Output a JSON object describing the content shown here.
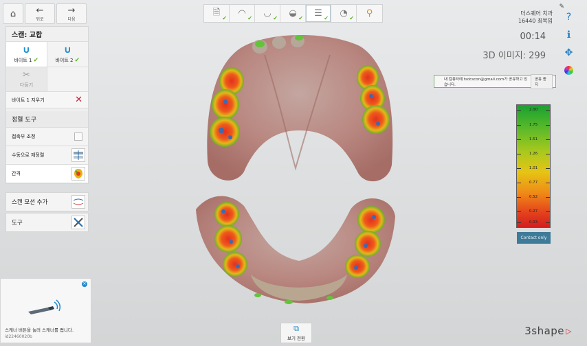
{
  "nav": {
    "home_icon": "home-icon",
    "back_label": "뒤로",
    "next_label": "다음"
  },
  "left_panel": {
    "title": "스캔: 교합",
    "bites": [
      {
        "label": "바이트 1",
        "state": "completed"
      },
      {
        "label": "바이트 2",
        "state": "completed"
      }
    ],
    "cut_label": "다듬기",
    "clear_bite_label": "바이트 1 지우기",
    "align_tools_header": "정렬 도구",
    "tools": [
      {
        "label": "접촉부 조정",
        "icon": "checkbox"
      },
      {
        "label": "수동으로 재정렬",
        "icon": "manual-align-icon"
      },
      {
        "label": "간격",
        "icon": "distance-map-icon"
      }
    ],
    "add_scan_motion": "스캔 모션 추가",
    "tools_label": "도구"
  },
  "workflow_steps": [
    {
      "name": "prescription",
      "done": true
    },
    {
      "name": "upper-jaw",
      "done": true
    },
    {
      "name": "lower-jaw",
      "done": true
    },
    {
      "name": "bite-left",
      "done": true
    },
    {
      "name": "bite",
      "done": true,
      "active": true
    },
    {
      "name": "analysis",
      "done": true
    },
    {
      "name": "send",
      "done": false
    }
  ],
  "header_right": {
    "clinic_name": "더스퀘어 치과",
    "patient": "16440 최복임",
    "timer": "00:14",
    "image_count": "3D 이미지: 299",
    "icons": [
      "help-icon",
      "info-icon",
      "settings-icon",
      "color-wheel-icon"
    ]
  },
  "share_bar": {
    "message": "내 컴퓨터에 tsdcscon@gmail.com가 공유하고 있습니다.",
    "button": "공유 종지"
  },
  "legend": {
    "ticks": [
      "2.00",
      "1.75",
      "1.51",
      "1.26",
      "1.01",
      "0.77",
      "0.52",
      "0.27",
      "0.03"
    ],
    "contact_button": "Contact only"
  },
  "scanner_hint": {
    "message": "스캐너 버튼을 눌러 스캐너를 켭니다.",
    "id": "id22460020b"
  },
  "view_switch": {
    "label": "보기 전환"
  },
  "brand": "3shape",
  "colors": {
    "accent": "#1d8fd1",
    "check": "#5cb32a",
    "danger": "#c0203a",
    "share_border": "#7cb06e",
    "contact_btn": "#3e7b99"
  }
}
